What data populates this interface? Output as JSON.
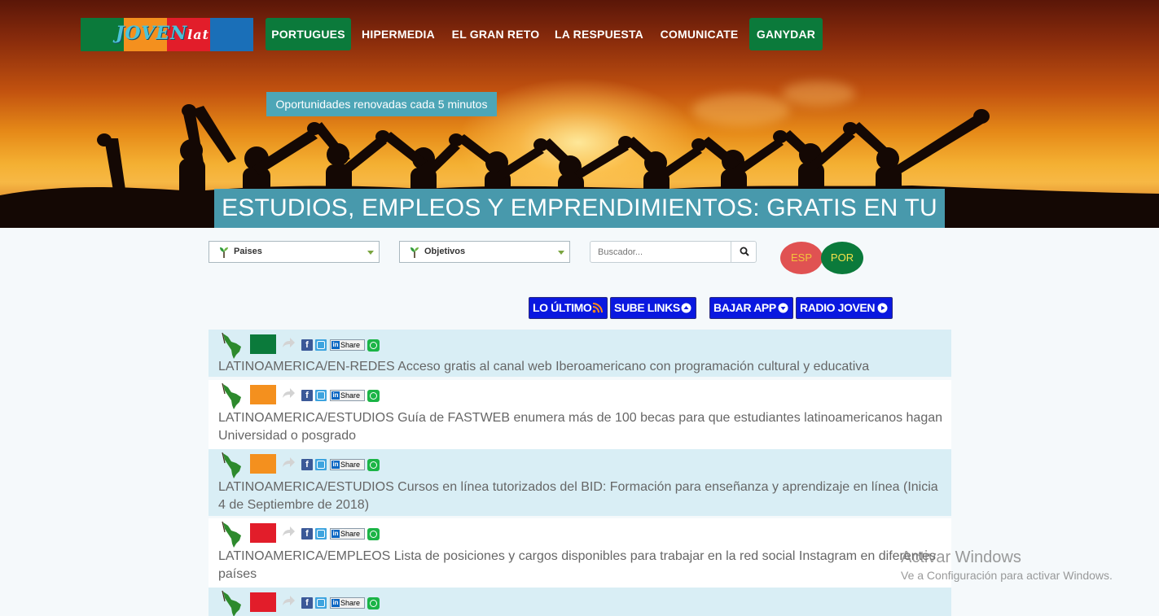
{
  "logo": {
    "text": "JOVEN",
    "suffix": "lat",
    "colors": [
      "#0b7a3b",
      "#f4901e",
      "#e21d2a",
      "#1a6fb8"
    ]
  },
  "nav": {
    "items": [
      {
        "label": "PORTUGUES",
        "active": true
      },
      {
        "label": "HIPERMEDIA",
        "active": false
      },
      {
        "label": "EL GRAN RETO",
        "active": false
      },
      {
        "label": "LA RESPUESTA",
        "active": false
      },
      {
        "label": "COMUNICATE",
        "active": false
      },
      {
        "label": "GANYDAR",
        "active": true
      }
    ]
  },
  "hero": {
    "badge": "Oportunidades renovadas cada 5 minutos",
    "banner": "ESTUDIOS, EMPLEOS Y EMPRENDIMIENTOS: GRATIS EN TU PAIS"
  },
  "filters": {
    "paises": "Paises",
    "objetivos": "Objetivos",
    "search_placeholder": "Buscador...",
    "search_icon": "search-icon"
  },
  "languages": {
    "esp": "ESP",
    "por": "POR"
  },
  "actions": [
    {
      "label": "LO ÚLTIMO",
      "icon": "rss-icon"
    },
    {
      "label": "SUBE LINKS",
      "icon": "upload-icon"
    },
    {
      "label": "BAJAR APP",
      "icon": "download-icon"
    },
    {
      "label": "RADIO JOVEN",
      "icon": "play-icon"
    }
  ],
  "share_labels": {
    "facebook": "f",
    "linkedin": "Share",
    "linkedin_in": "in"
  },
  "items": [
    {
      "title": "LATINOAMERICA/EN-REDES Acceso gratis al canal web Iberoamericano con programación cultural y educativa",
      "badge_color": "#0b7a3b"
    },
    {
      "title": "LATINOAMERICA/ESTUDIOS Guía de FASTWEB enumera más de 100 becas para que estudiantes latinoamericanos hagan Universidad o posgrado",
      "badge_color": "#f4901e"
    },
    {
      "title": "LATINOAMERICA/ESTUDIOS Cursos en línea tutorizados del BID: Formación para enseñanza y aprendizaje en línea (Inicia 4 de Septiembre de 2018)",
      "badge_color": "#f4901e"
    },
    {
      "title": "LATINOAMERICA/EMPLEOS Lista de posiciones y cargos disponibles para trabajar en la red social Instagram en diferentes países",
      "badge_color": "#e21d2a"
    },
    {
      "title": "",
      "badge_color": "#e21d2a"
    }
  ],
  "watermark": {
    "line1": "Activar Windows",
    "line2": "Ve a Configuración para activar Windows."
  }
}
